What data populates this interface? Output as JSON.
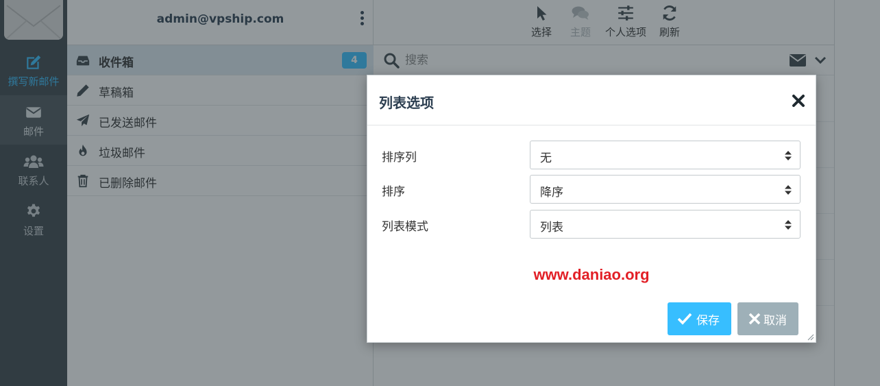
{
  "rail": {
    "compose_label": "撰写新邮件",
    "mail_label": "邮件",
    "contacts_label": "联系人",
    "settings_label": "设置"
  },
  "folders": {
    "account": "admin@vpship.com",
    "items": [
      {
        "label": "收件箱",
        "icon": "inbox-icon",
        "badge": "4"
      },
      {
        "label": "草稿箱",
        "icon": "pencil-icon"
      },
      {
        "label": "已发送邮件",
        "icon": "paper-plane-icon"
      },
      {
        "label": "垃圾邮件",
        "icon": "fire-icon"
      },
      {
        "label": "已删除邮件",
        "icon": "trash-icon"
      }
    ]
  },
  "toolbar": {
    "select_label": "选择",
    "threads_label": "主题",
    "options_label": "个人选项",
    "refresh_label": "刷新"
  },
  "search": {
    "placeholder": "搜索"
  },
  "dialog": {
    "title": "列表选项",
    "rows": [
      {
        "label": "排序列",
        "value": "无"
      },
      {
        "label": "排序",
        "value": "降序"
      },
      {
        "label": "列表模式",
        "value": "列表"
      }
    ],
    "watermark": "www.daniao.org",
    "save_label": "保存",
    "cancel_label": "取消"
  },
  "colors": {
    "accent": "#37beff",
    "rail": "#3a444a",
    "watermark": "#e21f26",
    "cancel": "#9eb0b8"
  }
}
